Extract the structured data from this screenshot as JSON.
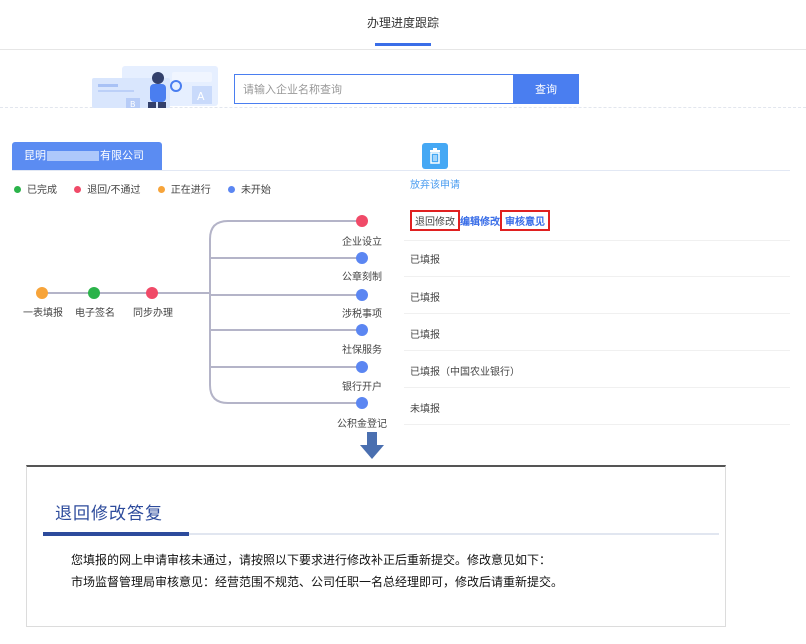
{
  "header": {
    "title": "办理进度跟踪"
  },
  "search": {
    "placeholder": "请输入企业名称查询",
    "button_label": "查询"
  },
  "company": {
    "name_prefix": "昆明",
    "name_suffix": "有限公司"
  },
  "abandon": {
    "label": "放弃该申请"
  },
  "legend": [
    {
      "label": "已完成",
      "color": "#2bb34a"
    },
    {
      "label": "退回/不通过",
      "color": "#f04a68"
    },
    {
      "label": "正在进行",
      "color": "#f7a43a"
    },
    {
      "label": "未开始",
      "color": "#5b86f2"
    }
  ],
  "main_steps": [
    {
      "label": "一表填报",
      "color": "#f7a43a"
    },
    {
      "label": "电子签名",
      "color": "#2bb34a"
    },
    {
      "label": "同步办理",
      "color": "#f04a68"
    }
  ],
  "branches": [
    {
      "label": "企业设立",
      "color": "#f04a68",
      "status": ""
    },
    {
      "label": "公章刻制",
      "color": "#5b86f2",
      "status": "已填报"
    },
    {
      "label": "涉税事项",
      "color": "#5b86f2",
      "status": "已填报"
    },
    {
      "label": "社保服务",
      "color": "#5b86f2",
      "status": "已填报"
    },
    {
      "label": "银行开户",
      "color": "#5b86f2",
      "status": "已填报（中国农业银行）"
    },
    {
      "label": "公积金登记",
      "color": "#5b86f2",
      "status": "未填报"
    }
  ],
  "first_branch_actions": {
    "returned": "退回修改",
    "edit": "编辑修改",
    "opinion": "审核意见"
  },
  "reply": {
    "title": "退回修改答复",
    "line1": "您填报的网上申请审核未通过，请按照以下要求进行修改补正后重新提交。修改意见如下：",
    "line2": "市场监督管理局审核意见：经营范围不规范、公司任职一名总经理即可，修改后请重新提交。"
  }
}
